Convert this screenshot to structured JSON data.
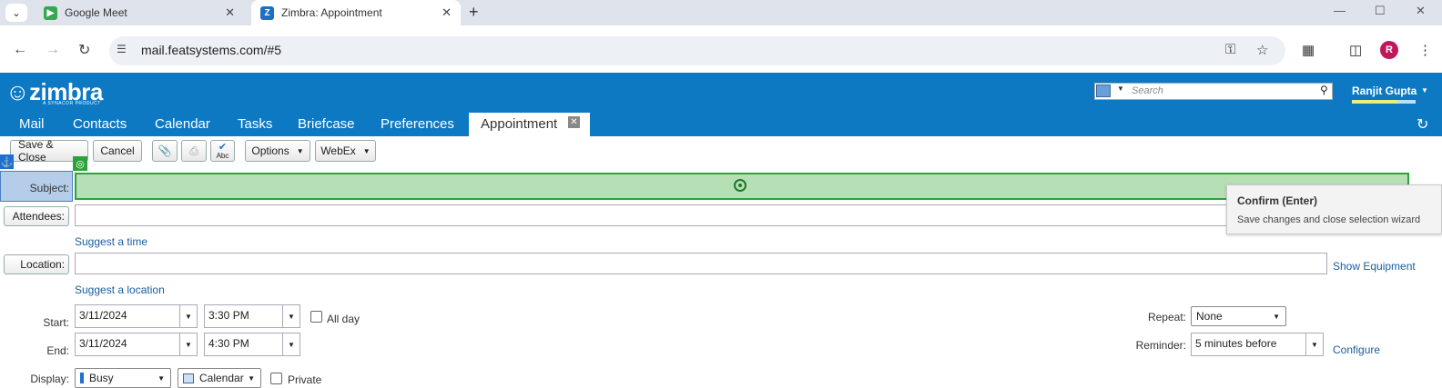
{
  "browser": {
    "tabs": [
      {
        "title": "Google Meet",
        "active": false
      },
      {
        "title": "Zimbra: Appointment",
        "active": true
      }
    ],
    "url": "mail.featsystems.com/#5",
    "profile_initial": "R",
    "colors": {
      "tabstrip": "#dfe3eb",
      "omnibox": "#edf0f5",
      "profile": "#c2185b"
    }
  },
  "zimbra": {
    "logo": "zimbra",
    "logo_sub": "A SYNACOR PRODUCT",
    "search_placeholder": "Search",
    "user_name": "Ranjit Gupta",
    "nav_tabs": [
      "Mail",
      "Contacts",
      "Calendar",
      "Tasks",
      "Briefcase",
      "Preferences"
    ],
    "active_tab": "Appointment",
    "colors": {
      "header": "#0d79c3",
      "link": "#1a5fa0"
    }
  },
  "toolbar": {
    "save_close": "Save & Close",
    "cancel": "Cancel",
    "options": "Options",
    "webex": "WebEx",
    "spell_label": "Abc"
  },
  "form": {
    "subject_label": "Subject:",
    "attendees_label": "Attendees:",
    "suggest_time": "Suggest a time",
    "location_label": "Location:",
    "show_equipment": "Show Equipment",
    "suggest_location": "Suggest a location",
    "start_label": "Start:",
    "start_date": "3/11/2024",
    "start_time": "3:30 PM",
    "all_day": "All day",
    "end_label": "End:",
    "end_date": "3/11/2024",
    "end_time": "4:30 PM",
    "display_label": "Display:",
    "display_value": "Busy",
    "calendar_value": "Calendar",
    "private_label": "Private",
    "repeat_label": "Repeat:",
    "repeat_value": "None",
    "reminder_label": "Reminder:",
    "reminder_value": "5 minutes before",
    "configure": "Configure"
  },
  "tooltip": {
    "title": "Confirm (Enter)",
    "description": "Save changes and close selection wizard"
  }
}
